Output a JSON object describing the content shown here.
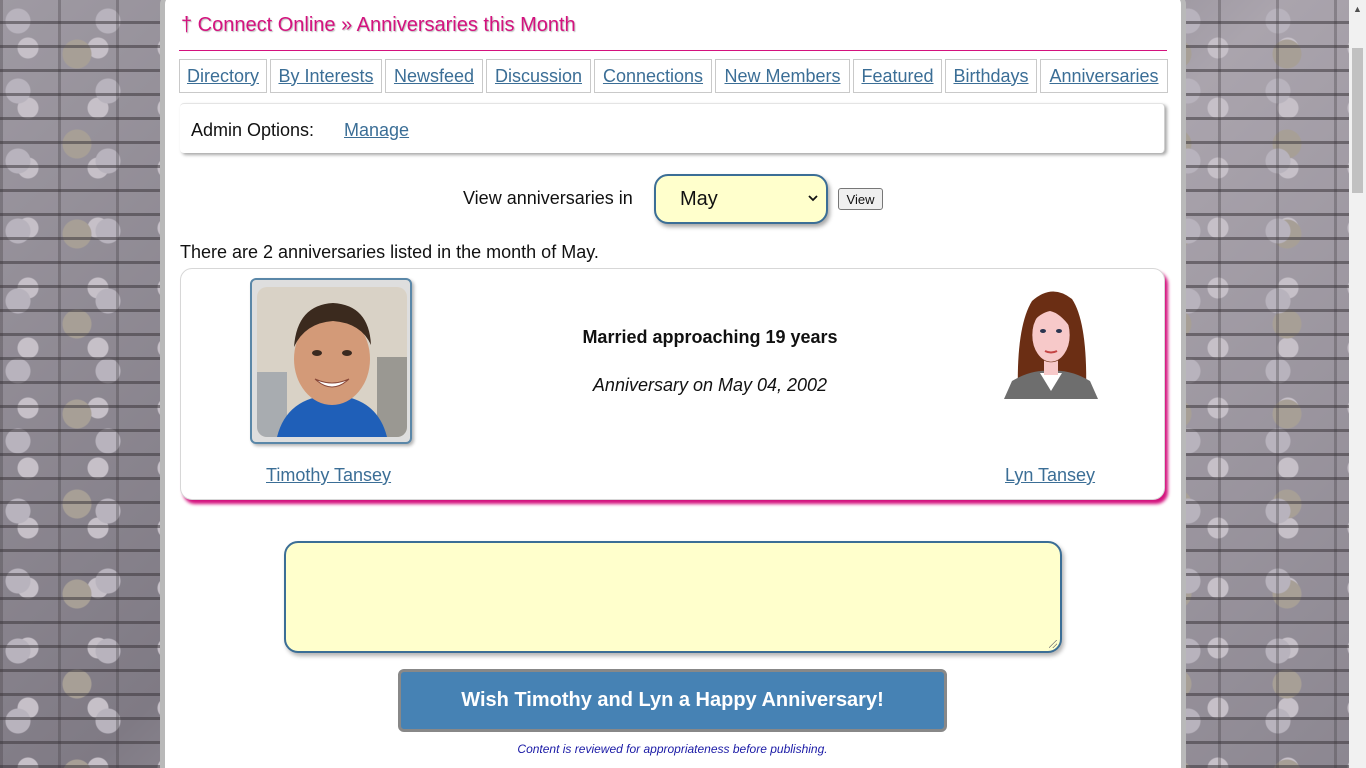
{
  "header": {
    "title": "† Connect Online » Anniversaries this Month"
  },
  "tabs": [
    {
      "label": "Directory"
    },
    {
      "label": "By Interests"
    },
    {
      "label": "Newsfeed"
    },
    {
      "label": "Discussion"
    },
    {
      "label": "Connections"
    },
    {
      "label": "New Members"
    },
    {
      "label": "Featured"
    },
    {
      "label": "Birthdays"
    },
    {
      "label": "Anniversaries"
    }
  ],
  "admin": {
    "label": "Admin Options:",
    "manage_link": "Manage"
  },
  "filter": {
    "label": "View anniversaries in",
    "selected_month": "May",
    "button_label": "View"
  },
  "summary_text": "There are 2 anniversaries listed in the month of May.",
  "anniversary": {
    "married_text": "Married approaching 19 years",
    "date_text": "Anniversary on May 04, 2002",
    "person1": "Timothy Tansey",
    "person2": "Lyn Tansey"
  },
  "message": {
    "value": "",
    "button_label": "Wish Timothy and Lyn a Happy Anniversary!",
    "note": "Content is reviewed for appropriateness before publishing."
  },
  "colors": {
    "accent": "#d4127e",
    "link": "#3b6e96",
    "button": "#4682b4",
    "input_bg": "#ffffcc"
  }
}
